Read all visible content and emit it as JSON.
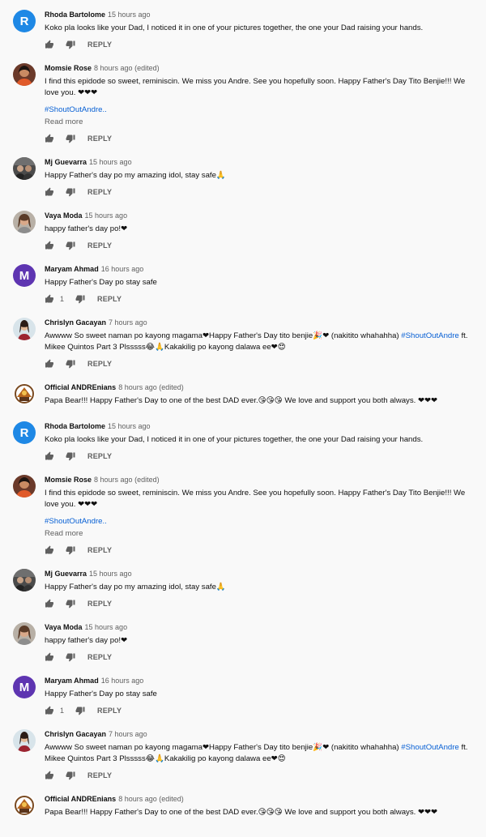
{
  "colors": {
    "link": "#065fd4",
    "muted": "#606060",
    "text": "#0f0f0f",
    "background": "#f9f9f9"
  },
  "comments": [
    {
      "author": "Rhoda Bartolome",
      "time": "15 hours ago",
      "avatar": {
        "type": "letter",
        "letter": "R",
        "color": "#1e88e5"
      },
      "text": "Koko  pla looks like your Dad, I noticed it in one of your pictures together, the one your Dad raising your hands.",
      "likes": "",
      "reply": "REPLY"
    },
    {
      "author": "Momsie Rose",
      "time": "8 hours ago (edited)",
      "avatar": {
        "type": "photo",
        "name": "woman-portrait"
      },
      "text": "I find this epidode so sweet,  reminiscin. We miss you Andre. See you hopefully soon. Happy Father's Day Tito Benjie!!! We love you. ❤❤❤",
      "tag": "#ShoutOutAndre..",
      "readmore": "Read more",
      "likes": "",
      "reply": "REPLY"
    },
    {
      "author": "Mj Guevarra",
      "time": "15 hours ago",
      "avatar": {
        "type": "photo",
        "name": "group-photo"
      },
      "text": "Happy Father's day po my amazing idol, stay safe🙏",
      "likes": "",
      "reply": "REPLY"
    },
    {
      "author": "Vaya Moda",
      "time": "15 hours ago",
      "avatar": {
        "type": "photo",
        "name": "woman-portrait-2"
      },
      "text": "happy father's day po!❤",
      "likes": "",
      "reply": "REPLY"
    },
    {
      "author": "Maryam Ahmad",
      "time": "16 hours ago",
      "avatar": {
        "type": "letter",
        "letter": "M",
        "color": "#5e35b1"
      },
      "text": "Happy Father's Day po stay safe",
      "likes": "1",
      "reply": "REPLY"
    },
    {
      "author": "Chrislyn Gacayan",
      "time": "7 hours ago",
      "avatar": {
        "type": "photo",
        "name": "girl-portrait"
      },
      "text_parts": [
        "Awwww So sweet naman po kayong magama❤Happy Father's Day tito benjie🎉❤ (nakitito whahahha) ",
        "#ShoutOutAndre",
        " ft. Mikee Quintos Part 3 Plsssss😂🙏Kakakilig po kayong dalawa ee❤😍"
      ],
      "likes": "",
      "reply": "REPLY"
    },
    {
      "author": "Official ANDREnians",
      "time": "8 hours ago (edited)",
      "avatar": {
        "type": "photo",
        "name": "logo-emblem"
      },
      "text": "Papa Bear!!! Happy Father's Day to one of the best DAD ever.😘😘😘 We love and support you both always. ❤❤❤",
      "likes": "",
      "reply": ""
    },
    {
      "author": "Rhoda Bartolome",
      "time": "15 hours ago",
      "avatar": {
        "type": "letter",
        "letter": "R",
        "color": "#1e88e5"
      },
      "text": "Koko  pla looks like your Dad, I noticed it in one of your pictures together, the one your Dad raising your hands.",
      "likes": "",
      "reply": "REPLY"
    },
    {
      "author": "Momsie Rose",
      "time": "8 hours ago (edited)",
      "avatar": {
        "type": "photo",
        "name": "woman-portrait"
      },
      "text": "I find this epidode so sweet,  reminiscin. We miss you Andre. See you hopefully soon. Happy Father's Day Tito Benjie!!! We love you. ❤❤❤",
      "tag": "#ShoutOutAndre..",
      "readmore": "Read more",
      "likes": "",
      "reply": "REPLY"
    },
    {
      "author": "Mj Guevarra",
      "time": "15 hours ago",
      "avatar": {
        "type": "photo",
        "name": "group-photo"
      },
      "text": "Happy Father's day po my amazing idol, stay safe🙏",
      "likes": "",
      "reply": "REPLY"
    },
    {
      "author": "Vaya Moda",
      "time": "15 hours ago",
      "avatar": {
        "type": "photo",
        "name": "woman-portrait-2"
      },
      "text": "happy father's day po!❤",
      "likes": "",
      "reply": "REPLY"
    },
    {
      "author": "Maryam Ahmad",
      "time": "16 hours ago",
      "avatar": {
        "type": "letter",
        "letter": "M",
        "color": "#5e35b1"
      },
      "text": "Happy Father's Day po stay safe",
      "likes": "1",
      "reply": "REPLY"
    },
    {
      "author": "Chrislyn Gacayan",
      "time": "7 hours ago",
      "avatar": {
        "type": "photo",
        "name": "girl-portrait"
      },
      "text_parts": [
        "Awwww So sweet naman po kayong magama❤Happy Father's Day tito benjie🎉❤ (nakitito whahahha) ",
        "#ShoutOutAndre",
        " ft. Mikee Quintos Part 3 Plsssss😂🙏Kakakilig po kayong dalawa ee❤😍"
      ],
      "likes": "",
      "reply": "REPLY"
    },
    {
      "author": "Official ANDREnians",
      "time": "8 hours ago (edited)",
      "avatar": {
        "type": "photo",
        "name": "logo-emblem"
      },
      "text": "Papa Bear!!! Happy Father's Day to one of the best DAD ever.😘😘😘 We love and support you both always. ❤❤❤",
      "likes": "",
      "reply": ""
    }
  ],
  "icons": {
    "like": "thumb-up-icon",
    "dislike": "thumb-down-icon"
  }
}
